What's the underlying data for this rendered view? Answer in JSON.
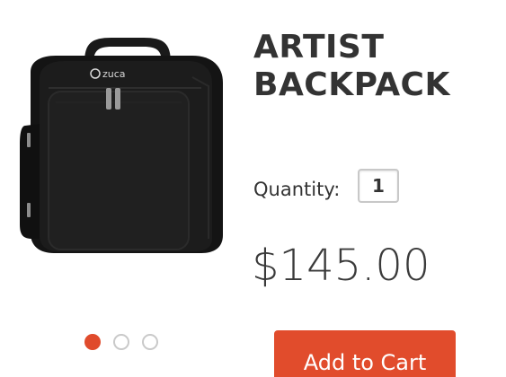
{
  "product": {
    "title_line1": "ARTIST",
    "title_line2": "BACKPACK",
    "brand_logo": "zuca",
    "image_icon": "backpack-image",
    "price": "$145.00"
  },
  "quantity": {
    "label": "Quantity:",
    "value": "1"
  },
  "carousel": {
    "total": 3,
    "active_index": 0
  },
  "actions": {
    "add_to_cart": "Add to Cart"
  },
  "colors": {
    "accent": "#e14c2c",
    "text": "#333333"
  }
}
